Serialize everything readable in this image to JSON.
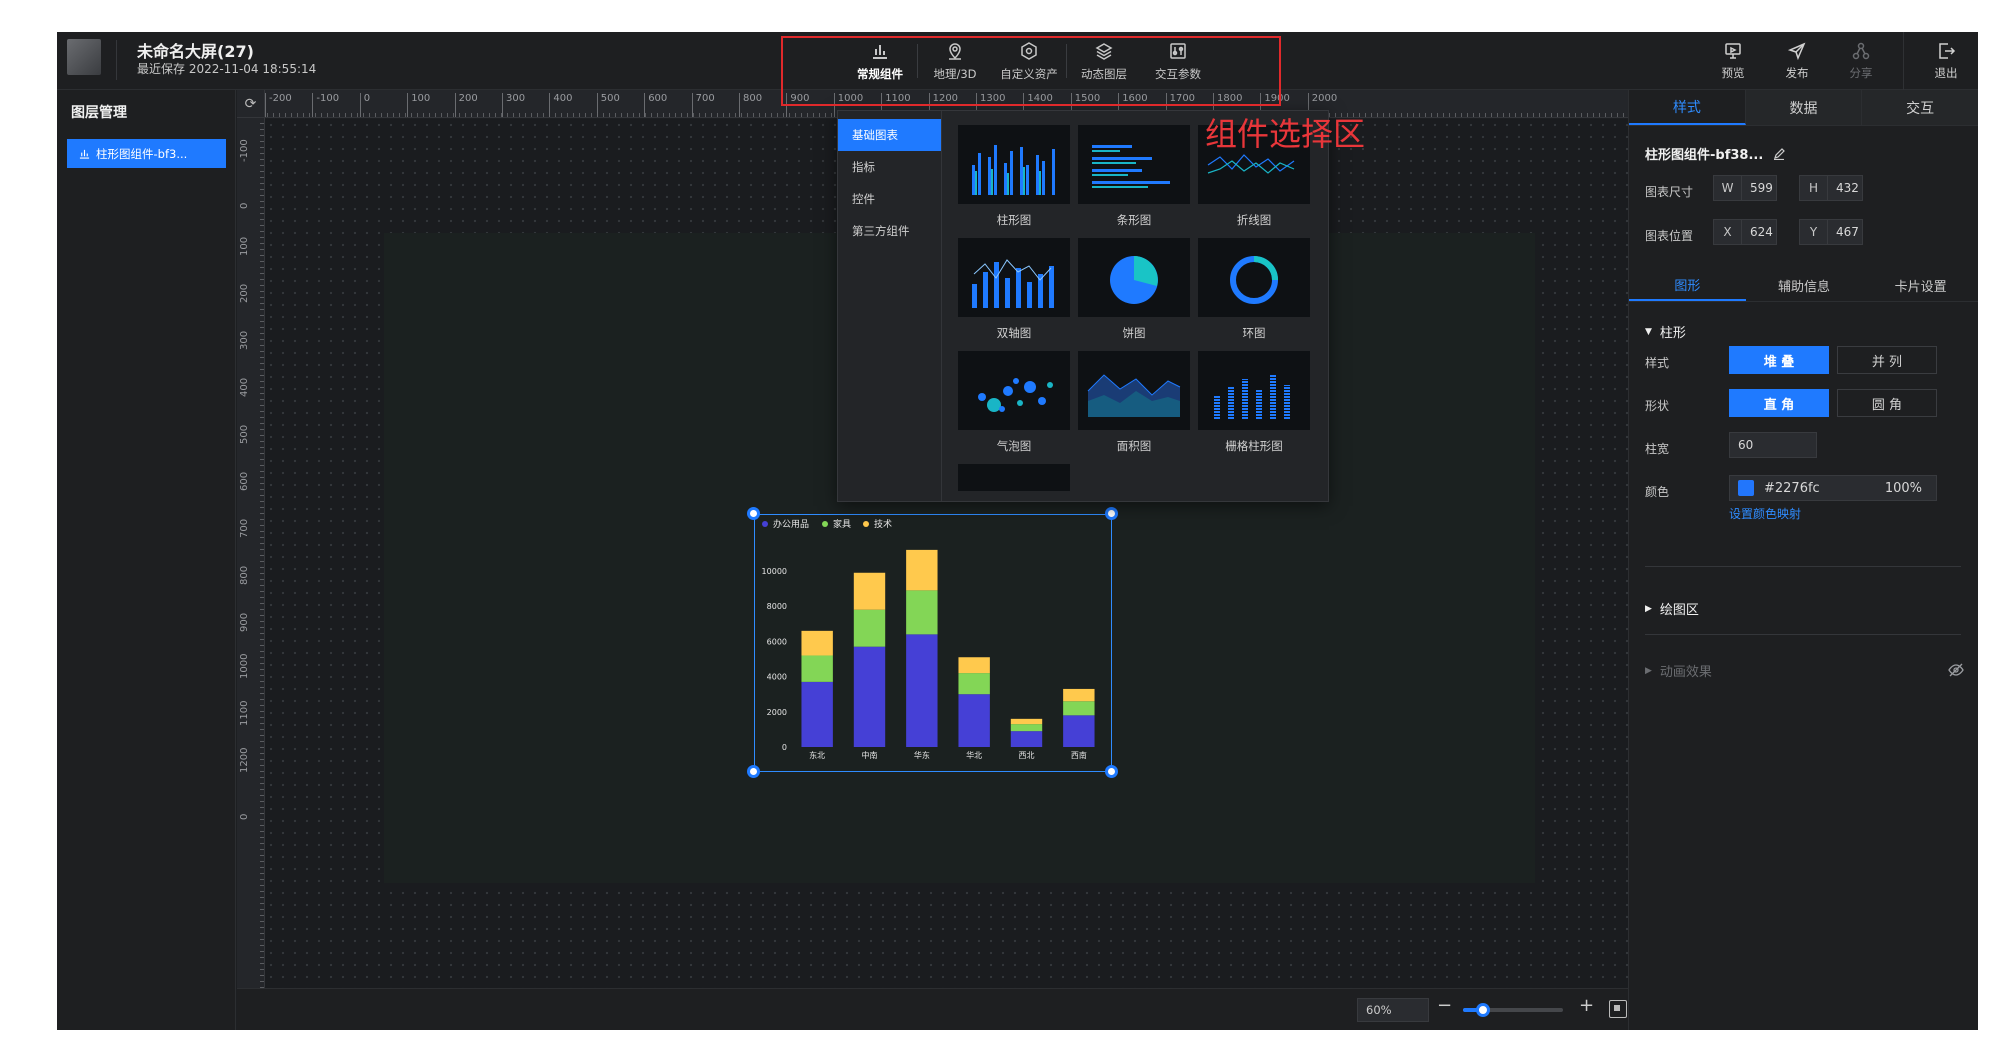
{
  "header": {
    "title": "未命名大屏(27)",
    "saved": "最近保存 2022-11-04 18:55:14"
  },
  "toolbar": [
    {
      "label": "常规组件",
      "icon": "bar-chart-icon"
    },
    {
      "label": "地理/3D",
      "icon": "map-pin-icon"
    },
    {
      "label": "自定义资产",
      "icon": "hexagon-icon"
    },
    {
      "label": "动态图层",
      "icon": "layers-icon"
    },
    {
      "label": "交互参数",
      "icon": "params-icon"
    }
  ],
  "annotation": {
    "label": "组件选择区",
    "color": "#e0292b"
  },
  "right_tools": [
    {
      "label": "预览",
      "icon": "preview-icon"
    },
    {
      "label": "发布",
      "icon": "send-icon"
    },
    {
      "label": "分享",
      "icon": "share-icon",
      "disabled": true
    },
    {
      "label": "退出",
      "icon": "exit-icon"
    }
  ],
  "left_panel": {
    "title": "图层管理",
    "layers": [
      {
        "label": "柱形图组件-bf3...",
        "icon": "bar-chart-icon"
      }
    ]
  },
  "ruler": {
    "h_labels": [
      "-200",
      "-100",
      "0",
      "100",
      "200",
      "300",
      "400",
      "500",
      "600",
      "700",
      "800",
      "900",
      "1000",
      "1100",
      "1200",
      "1300",
      "1400",
      "1500",
      "1600",
      "1700",
      "1800",
      "1900",
      "2000"
    ],
    "v_labels": [
      "-100",
      "0",
      "100",
      "200",
      "300",
      "400",
      "500",
      "600",
      "700",
      "800",
      "900",
      "1000",
      "1100",
      "1200",
      "0"
    ]
  },
  "zoom": {
    "value": "60%",
    "level": 0.2
  },
  "popup": {
    "categories": [
      "基础图表",
      "指标",
      "控件",
      "第三方组件"
    ],
    "items": [
      "柱形图",
      "条形图",
      "折线图",
      "双轴图",
      "饼图",
      "环图",
      "气泡图",
      "面积图",
      "栅格柱形图"
    ]
  },
  "chart_data": {
    "type": "bar",
    "stacked": true,
    "categories": [
      "东北",
      "中南",
      "华东",
      "华北",
      "西北",
      "西南"
    ],
    "series": [
      {
        "name": "办公用品",
        "color": "#4540d6",
        "values": [
          3700,
          5700,
          6400,
          3000,
          900,
          1800
        ]
      },
      {
        "name": "家具",
        "color": "#83d656",
        "values": [
          1500,
          2100,
          2500,
          1200,
          400,
          800
        ]
      },
      {
        "name": "技术",
        "color": "#ffc94d",
        "values": [
          1400,
          2100,
          2300,
          900,
          300,
          700
        ]
      }
    ],
    "yticks": [
      "10000",
      "8000",
      "6000",
      "4000",
      "2000",
      "0"
    ],
    "ylim": [
      0,
      10000
    ],
    "legend": "top-left"
  },
  "right_panel": {
    "tabs": [
      "样式",
      "数据",
      "交互"
    ],
    "component_name": "柱形图组件-bf38...",
    "size_label": "图表尺寸",
    "pos_label": "图表位置",
    "w_label": "W",
    "w_value": "599",
    "h_label": "H",
    "h_value": "432",
    "x_label": "X",
    "x_value": "624",
    "y_label": "Y",
    "y_value": "467",
    "subtabs": [
      "图形",
      "辅助信息",
      "卡片设置"
    ],
    "section_bar": "柱形",
    "style_label": "样式",
    "style_options": [
      "堆 叠",
      "并 列"
    ],
    "shape_label": "形状",
    "shape_options": [
      "直 角",
      "圆 角"
    ],
    "width_label": "柱宽",
    "width_value": "60",
    "color_label": "颜色",
    "color_value": "#2276fc",
    "color_swatch": "#2276fc",
    "color_opacity": "100%",
    "color_map": "设置颜色映射",
    "section_plot": "绘图区",
    "section_anim": "动画效果"
  }
}
